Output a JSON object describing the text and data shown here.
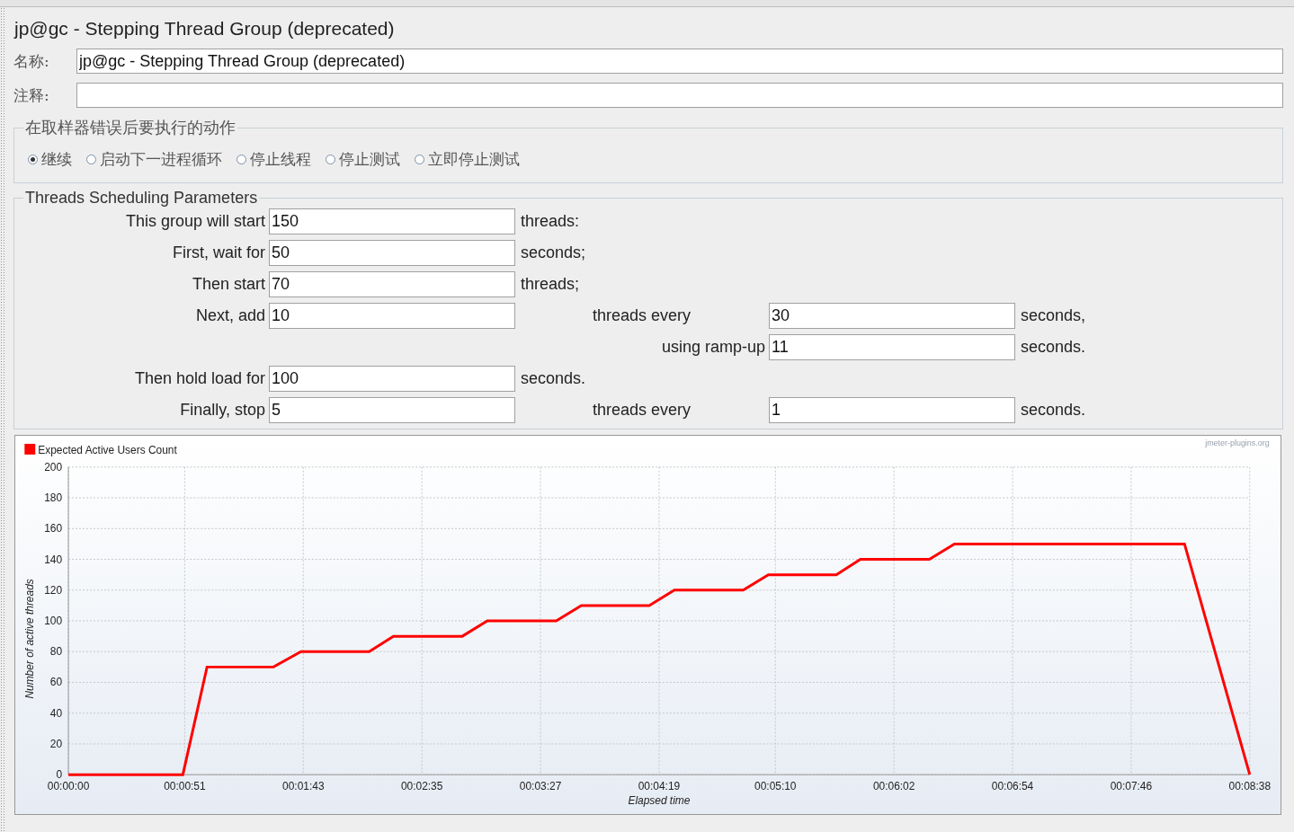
{
  "title": "jp@gc - Stepping Thread Group (deprecated)",
  "fields": [
    {
      "label": "名称:",
      "value": "jp@gc - Stepping Thread Group (deprecated)"
    },
    {
      "label": "注释:"
    }
  ],
  "error_action": {
    "title": "在取样器错误后要执行的动作",
    "options": [
      {
        "label": "继续",
        "selected": true
      },
      {
        "label": "启动下一进程循环",
        "selected": false
      },
      {
        "label": "停止线程",
        "selected": false
      },
      {
        "label": "停止测试",
        "selected": false
      },
      {
        "label": "立即停止测试",
        "selected": false
      }
    ]
  },
  "scheduling": {
    "title": "Threads Scheduling Parameters",
    "rows": [
      {
        "kind": "simple",
        "label": "This group will start",
        "value": "150",
        "unit": "threads:"
      },
      {
        "kind": "simple",
        "label": "First, wait for",
        "value": "50",
        "unit": "seconds;"
      },
      {
        "kind": "simple",
        "label": "Then start",
        "value": "70",
        "unit": "threads;"
      },
      {
        "kind": "double",
        "label": "Next, add",
        "value": "10",
        "mid_label": "threads every",
        "value_2": "30",
        "unit_2": "seconds,"
      },
      {
        "kind": "continuation",
        "mid_label": "using ramp-up",
        "value_2": "11",
        "unit_2": "seconds."
      },
      {
        "kind": "simple",
        "label": "Then hold load for",
        "value": "100",
        "unit": "seconds."
      },
      {
        "kind": "double",
        "label": "Finally, stop",
        "value": "5",
        "mid_label": "threads every",
        "value_2": "1",
        "unit_2": "seconds."
      }
    ]
  },
  "chart": {
    "credit": "jmeter-plugins.org",
    "chart_data": {
      "type": "line",
      "xlabel": "Elapsed time",
      "ylabel": "Number of active threads",
      "x": [
        0,
        50.2,
        60.8,
        89.9,
        102,
        131.9,
        142.5,
        172.7,
        183.7,
        213.9,
        224.9,
        254.7,
        265.7,
        295.9,
        306.9,
        336.7,
        347.3,
        377.5,
        388.5,
        489.4,
        518
      ],
      "series": [
        {
          "name": "Expected Active Users Count",
          "color": "#ff0000",
          "values": [
            0,
            0,
            70,
            70,
            80,
            80,
            90,
            90,
            100,
            100,
            110,
            110,
            120,
            120,
            130,
            130,
            140,
            140,
            150,
            150,
            0
          ]
        }
      ],
      "grid": true,
      "xlim": [
        0,
        518
      ],
      "ylim": [
        0,
        200
      ],
      "xticks": [
        {
          "value": 0,
          "label": "00:00:00"
        },
        {
          "value": 51,
          "label": "00:00:51"
        },
        {
          "value": 103,
          "label": "00:01:43"
        },
        {
          "value": 155,
          "label": "00:02:35"
        },
        {
          "value": 207,
          "label": "00:03:27"
        },
        {
          "value": 259,
          "label": "00:04:19"
        },
        {
          "value": 310,
          "label": "00:05:10"
        },
        {
          "value": 362,
          "label": "00:06:02"
        },
        {
          "value": 414,
          "label": "00:06:54"
        },
        {
          "value": 466,
          "label": "00:07:46"
        },
        {
          "value": 518,
          "label": "00:08:38"
        }
      ],
      "yticks": [
        0,
        20,
        40,
        60,
        80,
        100,
        120,
        140,
        160,
        180,
        200
      ]
    }
  }
}
